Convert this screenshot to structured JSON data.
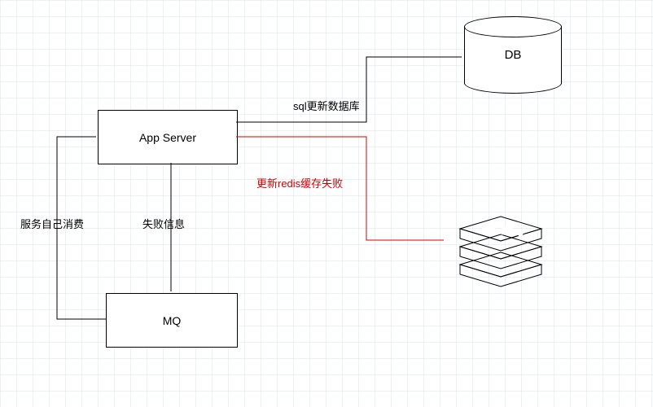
{
  "nodes": {
    "app_server": {
      "label": "App Server"
    },
    "mq": {
      "label": "MQ"
    },
    "db": {
      "label": "DB"
    },
    "redis": {
      "label": "Redis"
    }
  },
  "edges": {
    "app_to_db": {
      "label": "sql更新数据库",
      "color": "black"
    },
    "app_to_redis": {
      "label": "更新redis缓存失败",
      "color": "red"
    },
    "app_to_mq": {
      "label": "失败信息",
      "color": "black"
    },
    "mq_to_app": {
      "label": "服务自己消费",
      "color": "black"
    }
  },
  "diagram": {
    "description": "App Server updates DB via SQL; updating Redis cache fails; on failure a message is sent to MQ; the service itself consumes from MQ back to App Server."
  }
}
